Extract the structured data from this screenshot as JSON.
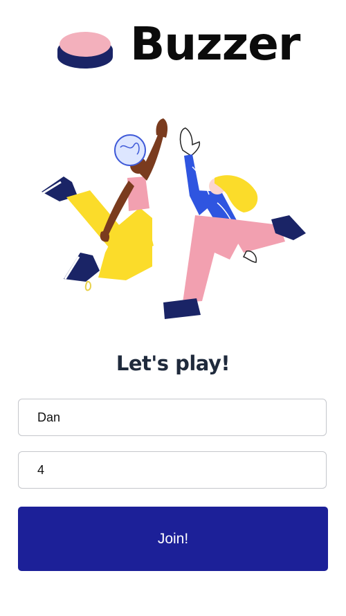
{
  "app": {
    "title": "Buzzer"
  },
  "main": {
    "heading": "Let's play!",
    "name_field": {
      "value": "Dan"
    },
    "room_field": {
      "value": "4"
    },
    "join_label": "Join!"
  },
  "colors": {
    "accent": "#1c2098",
    "buzzer_top": "#f3b0bc",
    "buzzer_base": "#1a2466",
    "heading_text": "#1f2a3c"
  },
  "icons": {
    "logo": "buzzer-button-icon"
  }
}
